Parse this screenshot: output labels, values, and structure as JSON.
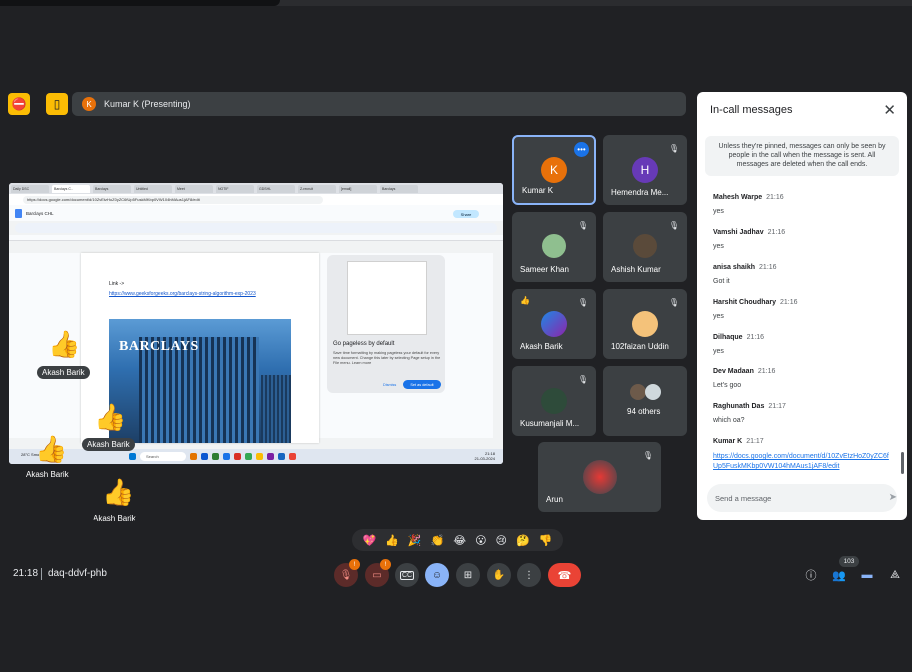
{
  "topbar": {
    "presenter_initial": "K",
    "presenter_label": "Kumar K (Presenting)"
  },
  "presentation": {
    "tabs": [
      "Daily DSC",
      "Barclays C..",
      "Barclays",
      "Untitled",
      "Meet",
      "NOTIF",
      "GDSHL",
      "Z-recruit",
      "[email]",
      "Barclays"
    ],
    "url": "https://docs.google.com/document/d/10ZvEtzHoZ0yZC6fUp5FuskMKbp0VW104hMAus1jAF8/edit",
    "doc_title": "Barclays CHL",
    "share_label": "Share",
    "link_label": "Link ->",
    "link_url": "https://www.geeksforgeeks.org/barclays-string-algorithm-exp-2023",
    "image_text": "BARCLAYS",
    "pageless_title": "Go pageless by default",
    "pageless_body": "Save time formatting by making pageless your default for every new document. Change this later by selecting Page setup in the File menu. Learn more",
    "pageless_dismiss": "Dismiss",
    "pageless_set": "Set as default",
    "taskbar_search": "Search",
    "weather": "28°C Smoke",
    "clock_time": "21:18",
    "clock_date": "21-03-2024"
  },
  "reactions": [
    {
      "emoji": "👍",
      "name": "Akash Barik"
    },
    {
      "emoji": "👍",
      "name": "Akash Barik"
    },
    {
      "emoji": "👍",
      "name": "Akash Barik"
    },
    {
      "emoji": "👍",
      "name": "Akash Barik"
    }
  ],
  "tiles": [
    {
      "name": "Kumar K",
      "initial": "K",
      "color": "#e8710a"
    },
    {
      "name": "Hemendra Me...",
      "initial": "H",
      "color": "#673ab7"
    },
    {
      "name": "Sameer Khan"
    },
    {
      "name": "Ashish Kumar"
    },
    {
      "name": "Akash Barik"
    },
    {
      "name": "102faizan Uddin"
    },
    {
      "name": "Kusumanjali M..."
    },
    {
      "name": "94 others"
    },
    {
      "name": "Arun"
    }
  ],
  "chat": {
    "title": "In-call messages",
    "note": "Unless they're pinned, messages can only be seen by people in the call when the message is sent. All messages are deleted when the call ends.",
    "messages": [
      {
        "name": "Mahesh Warpe",
        "time": "21:16",
        "text": "yes"
      },
      {
        "name": "Vamshi Jadhav",
        "time": "21:16",
        "text": "yes"
      },
      {
        "name": "anisa shaikh",
        "time": "21:16",
        "text": "Got it"
      },
      {
        "name": "Harshit Choudhary",
        "time": "21:16",
        "text": "yes"
      },
      {
        "name": "Dilhaque",
        "time": "21:16",
        "text": "yes"
      },
      {
        "name": "Dev Madaan",
        "time": "21:16",
        "text": "Let's goo"
      },
      {
        "name": "Raghunath Das",
        "time": "21:17",
        "text": "which oa?"
      },
      {
        "name": "Kumar K",
        "time": "21:17",
        "text": "https://docs.google.com/document/d/10ZvEtzHoZ0yZC6fUp5FuskMKbp0VW104hMAus1jAF8/edit"
      }
    ],
    "input_placeholder": "Send a message"
  },
  "emoji_bar": [
    "💖",
    "👍",
    "🎉",
    "👏",
    "😂",
    "😮",
    "😢",
    "🤔",
    "👎"
  ],
  "footer": {
    "time": "21:18",
    "meeting_code": "daq-ddvf-phb",
    "mic_badge": "!",
    "cam_badge": "!",
    "people_count": "103"
  }
}
